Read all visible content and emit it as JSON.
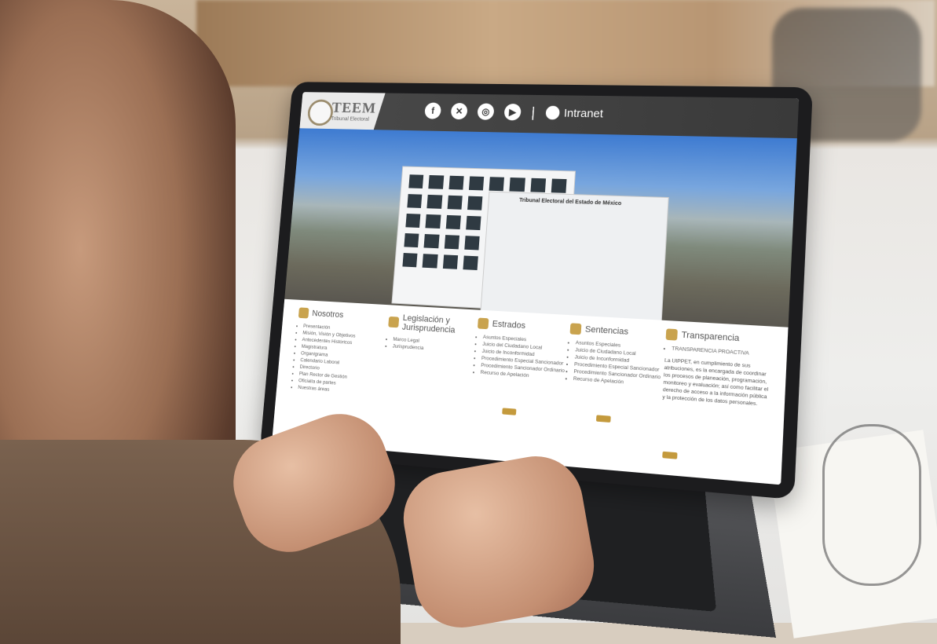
{
  "site": {
    "logo_main": "TEEM",
    "logo_sub": "Tribunal Electoral",
    "intranet_label": "Intranet",
    "separator": "|",
    "social_icons": [
      "facebook-icon",
      "x-icon",
      "instagram-icon",
      "youtube-icon"
    ],
    "building_sign": "Tribunal Electoral del Estado de México"
  },
  "menu": [
    {
      "title": "Nosotros",
      "items": [
        "Presentación",
        "Misión, Visión y Objetivos",
        "Antecedentes Históricos",
        "Magistratura",
        "Organigrama",
        "Calendario Laboral",
        "Directorio",
        "Plan Rector de Gestión",
        "Oficialía de partes",
        "Nuestras áreas"
      ]
    },
    {
      "title": "Legislación y Jurisprudencia",
      "items": [
        "Marco Legal",
        "Jurisprudencia"
      ]
    },
    {
      "title": "Estrados",
      "items": [
        "Asuntos Especiales",
        "Juicio del Ciudadano Local",
        "Juicio de Inconformidad",
        "Procedimiento Especial Sancionador",
        "Procedimiento Sancionador Ordinario",
        "Recurso de Apelación"
      ]
    },
    {
      "title": "Sentencias",
      "items": [
        "Asuntos Especiales",
        "Juicio de Ciudadano Local",
        "Juicio de Inconformidad",
        "Procedimiento Especial Sancionador",
        "Procedimiento Sancionador Ordinario",
        "Recurso de Apelación"
      ]
    },
    {
      "title": "Transparencia",
      "items": [
        "TRANSPARENCIA PROACTIVA"
      ],
      "text": "La UIPPET, en cumplimiento de sus atribuciones, es la encargada de coordinar los procesos de planeación, programación, monitoreo y evaluación; así como facilitar el derecho de acceso a la información pública y la protección de los datos personales."
    }
  ],
  "colors": {
    "accent": "#c9a34e",
    "topbar": "#3f3f3f"
  }
}
